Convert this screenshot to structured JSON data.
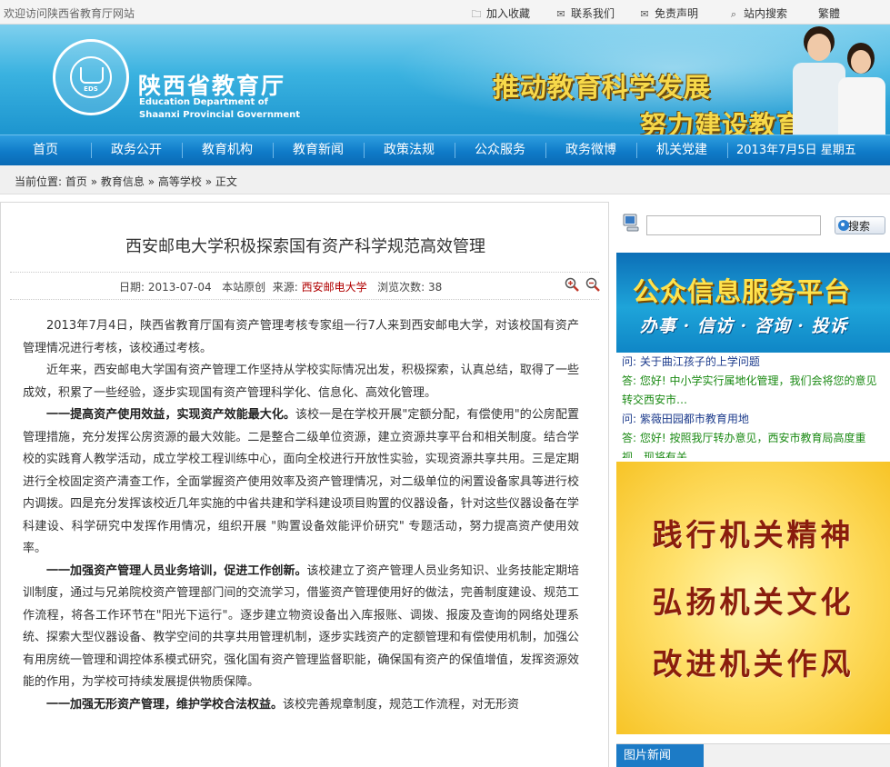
{
  "topbar": {
    "welcome": "欢迎访问陕西省教育厅网站",
    "links": [
      {
        "label": "加入收藏",
        "icon": "folder-icon"
      },
      {
        "label": "联系我们",
        "icon": "mail-icon"
      },
      {
        "label": "免责声明",
        "icon": "mail-icon"
      },
      {
        "label": "站内搜索",
        "icon": "search-icon"
      },
      {
        "label": "繁體",
        "icon": ""
      }
    ]
  },
  "banner": {
    "org_cn": "陕西省教育厅",
    "org_en_line1": "Education Department of",
    "org_en_line2": "Shaanxi Provincial Government",
    "seal_text": "EDS",
    "slogan_line1": "推动教育科学发展",
    "slogan_line2": "努力建设教育强省"
  },
  "nav": {
    "items": [
      "首页",
      "政务公开",
      "教育机构",
      "教育新闻",
      "政策法规",
      "公众服务",
      "政务微博",
      "机关党建"
    ],
    "date": "2013年7月5日 星期五"
  },
  "breadcrumb": {
    "prefix": "当前位置:",
    "items": [
      "首页",
      "教育信息",
      "高等学校",
      "正文"
    ],
    "separator": "»"
  },
  "article": {
    "title": "西安邮电大学积极探索国有资产科学规范高效管理",
    "meta": {
      "date_label": "日期:",
      "date": "2013-07-04",
      "origin": "本站原创",
      "source_label": "来源:",
      "source": "西安邮电大学",
      "views_label": "浏览次数:",
      "views": "38"
    },
    "paragraphs": [
      {
        "lead": "",
        "text": "2013年7月4日，陕西省教育厅国有资产管理考核专家组一行7人来到西安邮电大学，对该校国有资产管理情况进行考核，该校通过考核。"
      },
      {
        "lead": "",
        "text": "近年来，西安邮电大学国有资产管理工作坚持从学校实际情况出发，积极探索，认真总结，取得了一些成效，积累了一些经验，逐步实现国有资产管理科学化、信息化、高效化管理。"
      },
      {
        "lead": "一一提高资产使用效益，实现资产效能最大化。",
        "text": "该校一是在学校开展\"定额分配，有偿使用\"的公房配置管理措施，充分发挥公房资源的最大效能。二是整合二级单位资源，建立资源共享平台和相关制度。结合学校的实践育人教学活动，成立学校工程训练中心，面向全校进行开放性实验，实现资源共享共用。三是定期进行全校固定资产清查工作，全面掌握资产使用效率及资产管理情况，对二级单位的闲置设备家具等进行校内调拨。四是充分发挥该校近几年实施的中省共建和学科建设项目购置的仪器设备，针对这些仪器设备在学科建设、科学研究中发挥作用情况，组织开展 \"购置设备效能评价研究\" 专题活动，努力提高资产使用效率。"
      },
      {
        "lead": "一一加强资产管理人员业务培训，促进工作创新。",
        "text": "该校建立了资产管理人员业务知识、业务技能定期培训制度，通过与兄弟院校资产管理部门间的交流学习，借鉴资产管理使用好的做法，完善制度建设、规范工作流程，将各工作环节在\"阳光下运行\"。逐步建立物资设备出入库报账、调拨、报废及查询的网络处理系统、探索大型仪器设备、教学空间的共享共用管理机制，逐步实践资产的定额管理和有偿使用机制，加强公有用房统一管理和调控体系模式研究，强化国有资产管理监督职能，确保国有资产的保值增值，发挥资源效能的作用，为学校可持续发展提供物质保障。"
      },
      {
        "lead": "一一加强无形资产管理，维护学校合法权益。",
        "text": "该校完善规章制度，规范工作流程，对无形资"
      }
    ]
  },
  "sidebar": {
    "search_placeholder": "",
    "search_button": "搜索",
    "service_title": "公众信息服务平台",
    "service_subtitle": "办事 · 信访 · 咨询 · 投诉",
    "qa": [
      {
        "type": "q",
        "text": "问: 关于曲江孩子的上学问题"
      },
      {
        "type": "a",
        "text": "答: 您好! 中小学实行属地化管理，我们会将您的意见转交西安市…"
      },
      {
        "type": "q",
        "text": "问: 紫薇田园都市教育用地"
      },
      {
        "type": "a",
        "text": "答: 您好! 按照我厅转办意见，西安市教育局高度重视，现将有关"
      }
    ],
    "ad_lines": [
      "践行机关精神",
      "弘扬机关文化",
      "改进机关作风"
    ],
    "photo_news_label": "图片新闻"
  },
  "colors": {
    "nav_blue": "#0f7bc8",
    "source_red": "#b00000",
    "qa_question": "#1c3b8c",
    "qa_answer": "#1b8a14",
    "ad_text": "#8a1d0d",
    "slogan_gold": "#f7d94a"
  }
}
